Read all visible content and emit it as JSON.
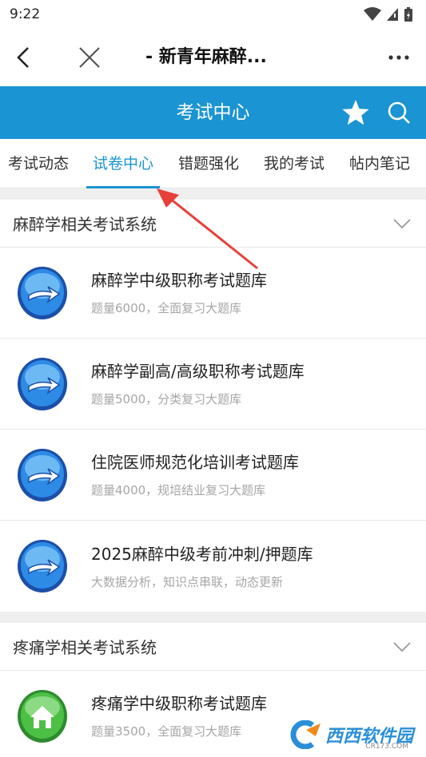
{
  "status_bar": {
    "time": "9:22"
  },
  "titlebar": {
    "title": "- 新青年麻醉..."
  },
  "header": {
    "title": "考试中心"
  },
  "tabs": [
    {
      "label": "考试动态"
    },
    {
      "label": "试卷中心"
    },
    {
      "label": "错题强化"
    },
    {
      "label": "我的考试"
    },
    {
      "label": "帖内笔记"
    }
  ],
  "sections": [
    {
      "title": "麻醉学相关考试系统",
      "items": [
        {
          "title": "麻醉学中级职称考试题库",
          "subtitle": "题量6000，全面复习大题库",
          "icon": "arrow-icon"
        },
        {
          "title": "麻醉学副高/高级职称考试题库",
          "subtitle": "题量5000，分类复习大题库",
          "icon": "arrow-icon"
        },
        {
          "title": "住院医师规范化培训考试题库",
          "subtitle": "题量4000，规培结业复习大题库",
          "icon": "arrow-icon"
        },
        {
          "title": "2025麻醉中级考前冲刺/押题库",
          "subtitle": "大数据分析，知识点串联，动态更新",
          "icon": "arrow-icon"
        }
      ]
    },
    {
      "title": "疼痛学相关考试系统",
      "items": [
        {
          "title": "疼痛学中级职称考试题库",
          "subtitle": "题量3500，全面复习大题库",
          "icon": "home-icon"
        }
      ]
    }
  ],
  "watermark": {
    "text": "西西软件园",
    "url": "CR173.COM"
  },
  "colors": {
    "primary": "#1a94d2",
    "annotation": "#e8403a"
  }
}
